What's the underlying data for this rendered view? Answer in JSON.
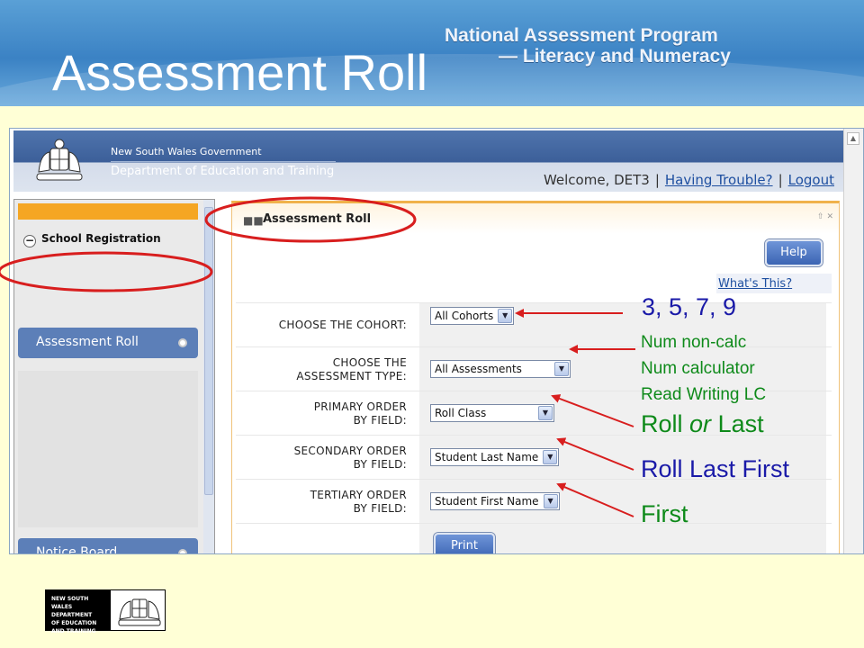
{
  "slide": {
    "title": "Assessment Roll",
    "program_line1": "National Assessment Program",
    "program_line2": "— Literacy and Numeracy"
  },
  "app": {
    "gov_line1": "New South Wales Government",
    "gov_line2": "Department of Education and Training",
    "welcome_text": "Welcome, DET3",
    "having_trouble": "Having Trouble?",
    "logout": "Logout",
    "separator": "|"
  },
  "sidebar": {
    "section_label": "School Registration",
    "section_toggle": "−",
    "items": [
      {
        "label": "Assessment Roll"
      },
      {
        "label": "Notice Board"
      }
    ]
  },
  "panel": {
    "title": "Assessment Roll",
    "controls": "⇧ ✕",
    "help_label": "Help",
    "whats_this": "What's This?",
    "rows": [
      {
        "label": "CHOOSE THE COHORT:",
        "selected": "All Cohorts"
      },
      {
        "label": "CHOOSE THE ASSESSMENT TYPE:",
        "selected": "All Assessments"
      },
      {
        "label": "PRIMARY ORDER BY FIELD:",
        "selected": "Roll Class"
      },
      {
        "label": "SECONDARY ORDER BY FIELD:",
        "selected": "Student Last Name"
      },
      {
        "label": "TERTIARY ORDER BY FIELD:",
        "selected": "Student First Name"
      }
    ],
    "print_label": "Print"
  },
  "annotations": {
    "cohort": "3, 5, 7, 9",
    "type_lines": [
      "Num non-calc",
      "Num calculator",
      "Read Writing LC"
    ],
    "primary_a": "Roll",
    "primary_or": "or",
    "primary_b": "Last",
    "secondary": "Roll Last First",
    "tertiary": "First"
  },
  "footer": {
    "logo_lines": [
      "NEW SOUTH WALES",
      "DEPARTMENT",
      "OF EDUCATION",
      "AND TRAINING"
    ]
  },
  "colors": {
    "annotation_blue": "#1a1aa8",
    "annotation_green": "#0e8a1a",
    "arrow_red": "#d81e1e",
    "accent_orange": "#f5a623",
    "sidebar_blue": "#5c7fb8"
  }
}
